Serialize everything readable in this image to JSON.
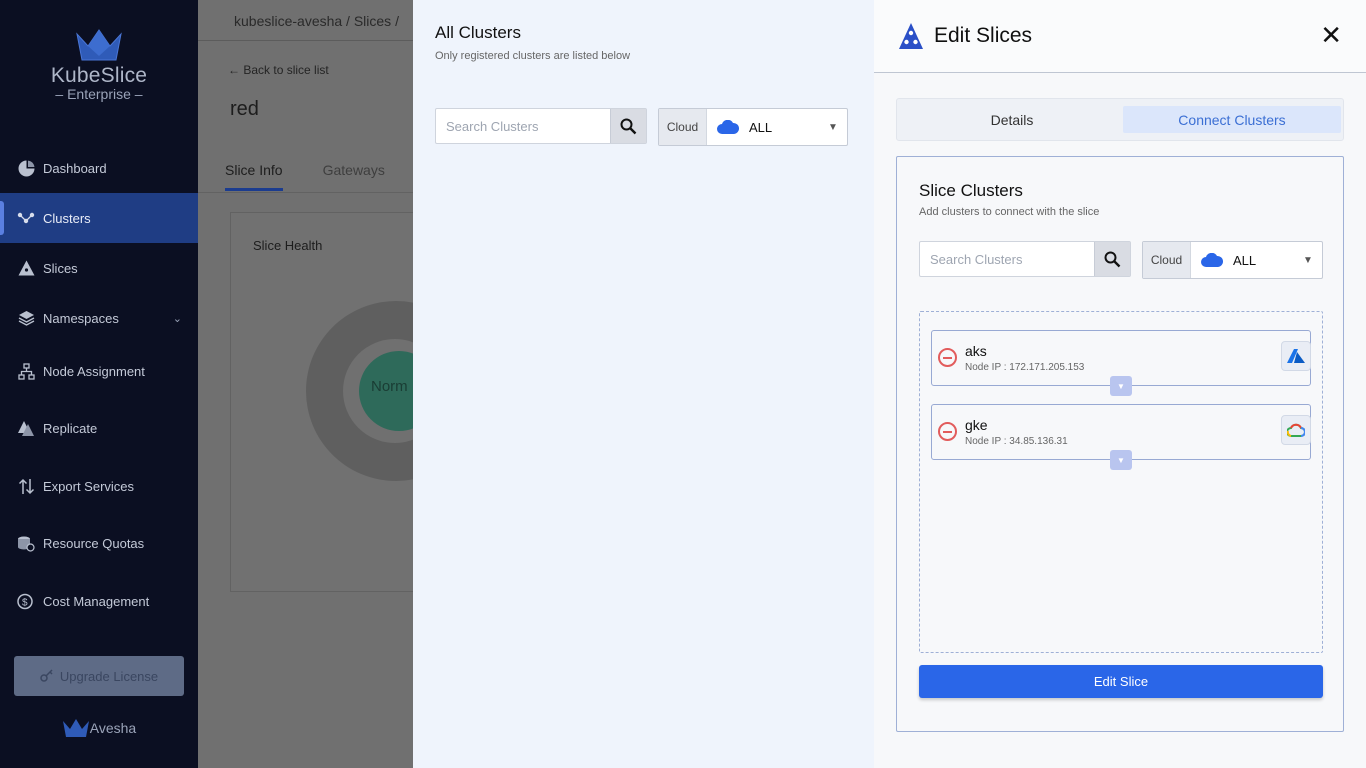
{
  "sidebar": {
    "brand": "KubeSlice",
    "edition": "Enterprise",
    "items": [
      {
        "label": "Dashboard",
        "icon": "dashboard-icon"
      },
      {
        "label": "Clusters",
        "icon": "clusters-icon",
        "active": true
      },
      {
        "label": "Slices",
        "icon": "slices-icon"
      },
      {
        "label": "Namespaces",
        "icon": "namespaces-icon"
      },
      {
        "label": "Node Assignment",
        "icon": "node-assignment-icon"
      },
      {
        "label": "Replicate",
        "icon": "replicate-icon"
      },
      {
        "label": "Export Services",
        "icon": "export-services-icon"
      },
      {
        "label": "Resource Quotas",
        "icon": "resource-quotas-icon"
      },
      {
        "label": "Cost Management",
        "icon": "cost-management-icon"
      }
    ],
    "upgrade_label": "Upgrade License",
    "footer_brand": "Avesha"
  },
  "page": {
    "breadcrumb": "kubeslice-avesha / Slices /",
    "back_label": "Back to slice list",
    "slice_name": "red",
    "tabs": [
      "Slice Info",
      "Gateways"
    ],
    "card_title": "Slice Health",
    "health_status": "Norm"
  },
  "all_clusters": {
    "title": "All Clusters",
    "subtitle": "Only registered clusters are listed below",
    "search_placeholder": "Search Clusters",
    "cloud_label": "Cloud",
    "cloud_value": "ALL"
  },
  "edit_panel": {
    "title": "Edit Slices",
    "tabs": {
      "details": "Details",
      "connect": "Connect Clusters"
    },
    "section_title": "Slice Clusters",
    "section_subtitle": "Add clusters to connect with the slice",
    "search_placeholder": "Search Clusters",
    "cloud_label": "Cloud",
    "cloud_value": "ALL",
    "clusters": [
      {
        "name": "aks",
        "node_ip": "Node IP : 172.171.205.153",
        "provider_icon": "azure-icon"
      },
      {
        "name": "gke",
        "node_ip": "Node IP : 34.85.136.31",
        "provider_icon": "gcp-icon"
      }
    ],
    "submit_label": "Edit Slice"
  },
  "colors": {
    "accent": "#2a66e8",
    "sidebar_bg": "#0b0f22",
    "active_nav": "#1f3d84",
    "remove": "#e25c5c"
  }
}
